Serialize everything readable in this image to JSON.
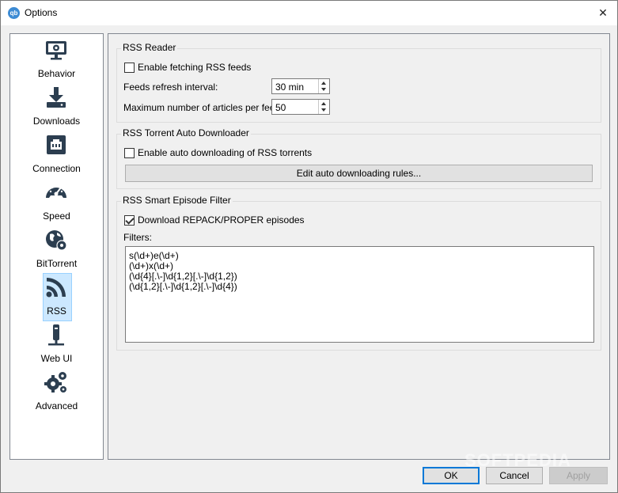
{
  "window": {
    "title": "Options",
    "app_icon_text": "qb"
  },
  "sidebar": {
    "items": [
      {
        "label": "Behavior",
        "icon": "monitor-icon"
      },
      {
        "label": "Downloads",
        "icon": "download-icon"
      },
      {
        "label": "Connection",
        "icon": "network-icon"
      },
      {
        "label": "Speed",
        "icon": "speedometer-icon"
      },
      {
        "label": "BitTorrent",
        "icon": "globe-gear-icon"
      },
      {
        "label": "RSS",
        "icon": "rss-icon"
      },
      {
        "label": "Web UI",
        "icon": "web-ui-icon"
      },
      {
        "label": "Advanced",
        "icon": "gears-icon"
      }
    ],
    "selected": "RSS"
  },
  "rss_reader": {
    "title": "RSS Reader",
    "enable_label": "Enable fetching RSS feeds",
    "enable_checked": false,
    "refresh_label": "Feeds refresh interval:",
    "refresh_value": "30 min",
    "max_articles_label": "Maximum number of articles per feed:",
    "max_articles_value": "50"
  },
  "auto_downloader": {
    "title": "RSS Torrent Auto Downloader",
    "enable_label": "Enable auto downloading of RSS torrents",
    "enable_checked": false,
    "edit_rules_label": "Edit auto downloading rules..."
  },
  "smart_filter": {
    "title": "RSS Smart Episode Filter",
    "repack_label": "Download REPACK/PROPER episodes",
    "repack_checked": true,
    "filters_label": "Filters:",
    "filters": [
      "s(\\d+)e(\\d+)",
      "(\\d+)x(\\d+)",
      "(\\d{4}[.\\-]\\d{1,2}[.\\-]\\d{1,2})",
      "(\\d{1,2}[.\\-]\\d{1,2}[.\\-]\\d{4})"
    ]
  },
  "buttons": {
    "ok": "OK",
    "cancel": "Cancel",
    "apply": "Apply"
  },
  "watermark": "SOFTPEDIA",
  "colors": {
    "accent": "#0078d7",
    "selection": "#cce8ff",
    "icon": "#2c3e50"
  }
}
